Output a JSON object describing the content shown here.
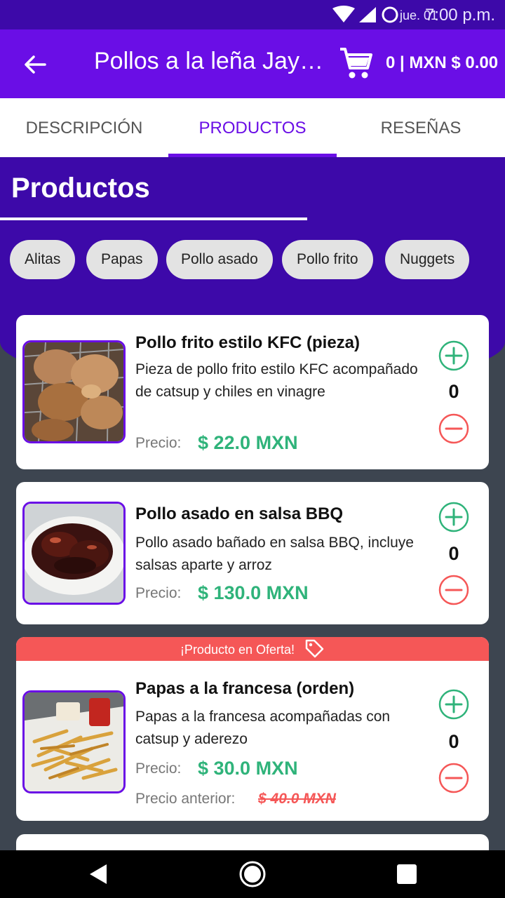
{
  "status_bar": {
    "date": "jue. 01",
    "time": "7:00 p.m."
  },
  "app_bar": {
    "title": "Pollos a la leña Jaydn's",
    "cart_summary": "0 | MXN $ 0.00"
  },
  "tabs": [
    {
      "label": "DESCRIPCIÓN",
      "active": false
    },
    {
      "label": "PRODUCTOS",
      "active": true
    },
    {
      "label": "RESEÑAS",
      "active": false
    }
  ],
  "section": {
    "title": "Productos"
  },
  "categories": [
    "Alitas",
    "Papas",
    "Pollo asado",
    "Pollo frito",
    "Nuggets"
  ],
  "labels": {
    "price": "Precio:",
    "previous_price": "Precio anterior:",
    "offer_banner": "¡Producto en Oferta!"
  },
  "products": [
    {
      "name": "Pollo frito estilo KFC (pieza)",
      "description": "Pieza de pollo frito estilo KFC acompañado de catsup y chiles en vinagre",
      "price": "$ 22.0 MXN",
      "quantity": "0",
      "on_offer": false
    },
    {
      "name": "Pollo asado en salsa BBQ",
      "description": "Pollo asado bañado en salsa BBQ, incluye salsas aparte y arroz",
      "price": "$ 130.0 MXN",
      "quantity": "0",
      "on_offer": false
    },
    {
      "name": "Papas a la francesa (orden)",
      "description": "Papas a la francesa acompañadas con catsup y aderezo",
      "price": "$ 30.0 MXN",
      "previous_price": "$ 40.0 MXN",
      "quantity": "0",
      "on_offer": true
    }
  ],
  "colors": {
    "primary": "#6a0ee6",
    "primary_dark": "#3d09a9",
    "price_green": "#2fb37a",
    "offer_red": "#f55757",
    "background": "#3d4550"
  },
  "icons": {
    "back": "arrow-left-icon",
    "cart": "cart-icon",
    "add": "plus-circle-icon",
    "remove": "minus-circle-icon",
    "offer": "tag-icon"
  }
}
